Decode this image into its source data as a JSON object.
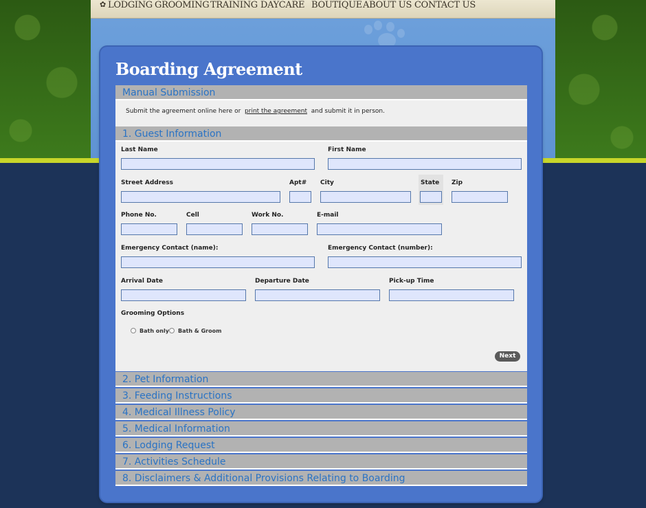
{
  "nav": {
    "items": [
      "LODGING",
      "GROOMING",
      "TRAINING",
      "DAYCARE",
      "BOUTIQUE",
      "ABOUT US",
      "CONTACT US"
    ]
  },
  "page": {
    "title": "Boarding Agreement"
  },
  "manual": {
    "heading": "Manual Submission",
    "text_before": "Submit the agreement online here or",
    "link": "print the agreement",
    "text_after": "and submit it in person."
  },
  "guest": {
    "heading": "1. Guest Information",
    "labels": {
      "last_name": "Last Name",
      "first_name": "First Name",
      "street": "Street Address",
      "apt": "Apt#",
      "city": "City",
      "state": "State",
      "zip": "Zip",
      "phone": "Phone No.",
      "cell": "Cell",
      "work": "Work No.",
      "email": "E-mail",
      "emerg_name": "Emergency Contact (name):",
      "emerg_number": "Emergency Contact (number):",
      "arrival": "Arrival Date",
      "departure": "Departure Date",
      "pickup": "Pick-up Time",
      "grooming": "Grooming Options"
    },
    "grooming_options": [
      "Bath only",
      "Bath & Groom"
    ],
    "next_label": "Next"
  },
  "sections": [
    "2. Pet Information",
    "3. Feeding Instructions",
    "4. Medical Illness Policy",
    "5. Medical Information",
    "6. Lodging Request",
    "7. Activities Schedule",
    "8. Disclaimers & Additional Provisions Relating to Boarding"
  ],
  "colors": {
    "panel": "#4a75cb",
    "section_bar": "#b2b2b2",
    "section_text": "#2a73c4",
    "input_bg": "#dfe6fc"
  }
}
